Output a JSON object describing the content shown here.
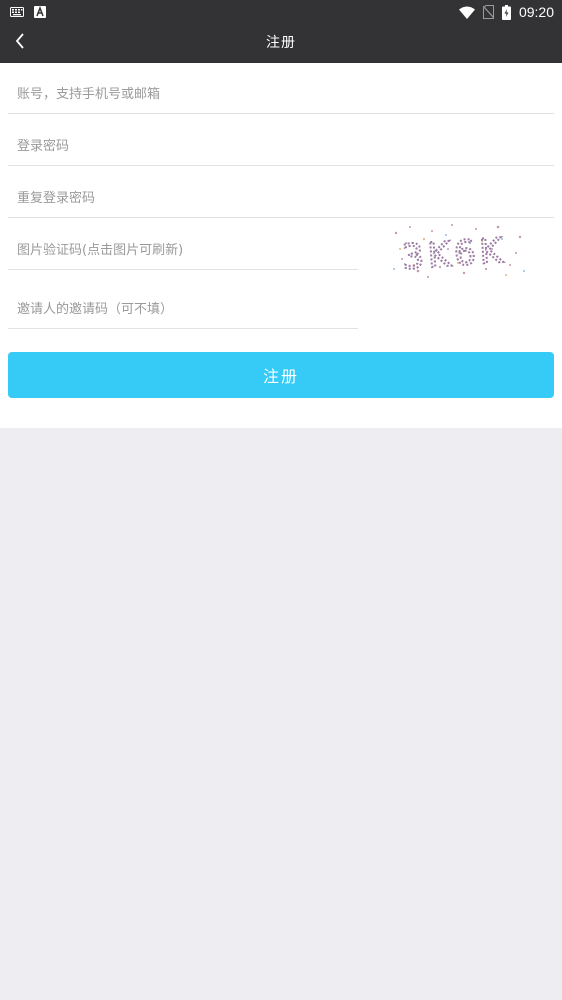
{
  "status_bar": {
    "time": "09:20",
    "icons": [
      "keyboard-icon",
      "a-icon",
      "wifi-icon",
      "no-sim-icon",
      "battery-icon"
    ]
  },
  "header": {
    "title": "注册",
    "back_icon": "chevron-left-icon"
  },
  "form": {
    "account": {
      "placeholder": "账号，支持手机号或邮箱"
    },
    "password": {
      "placeholder": "登录密码"
    },
    "password_repeat": {
      "placeholder": "重复登录密码"
    },
    "captcha": {
      "placeholder": "图片验证码(点击图片可刷新)",
      "image_text": "3K6K"
    },
    "invite": {
      "placeholder": "邀请人的邀请码（可不填）"
    },
    "submit_label": "注册"
  },
  "colors": {
    "bar": "#333335",
    "accent": "#35cbf6",
    "background": "#ededf2"
  }
}
